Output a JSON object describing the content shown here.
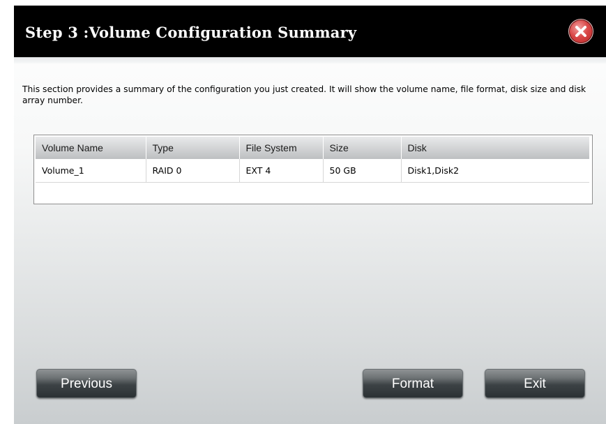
{
  "dialog": {
    "title": "Step 3 :Volume Configuration Summary",
    "close_icon": "close-icon",
    "description": "This section provides a summary of the configuration you just created. It will show the volume name, file format, disk size and disk array number."
  },
  "table": {
    "headers": [
      "Volume Name",
      "Type",
      "File System",
      "Size",
      "Disk"
    ],
    "rows": [
      [
        "Volume_1",
        "RAID 0",
        "EXT 4",
        "50 GB",
        "Disk1,Disk2"
      ]
    ]
  },
  "buttons": {
    "previous": "Previous",
    "format": "Format",
    "exit": "Exit"
  },
  "colors": {
    "titlebar": "#000000",
    "close": "#d94848"
  }
}
